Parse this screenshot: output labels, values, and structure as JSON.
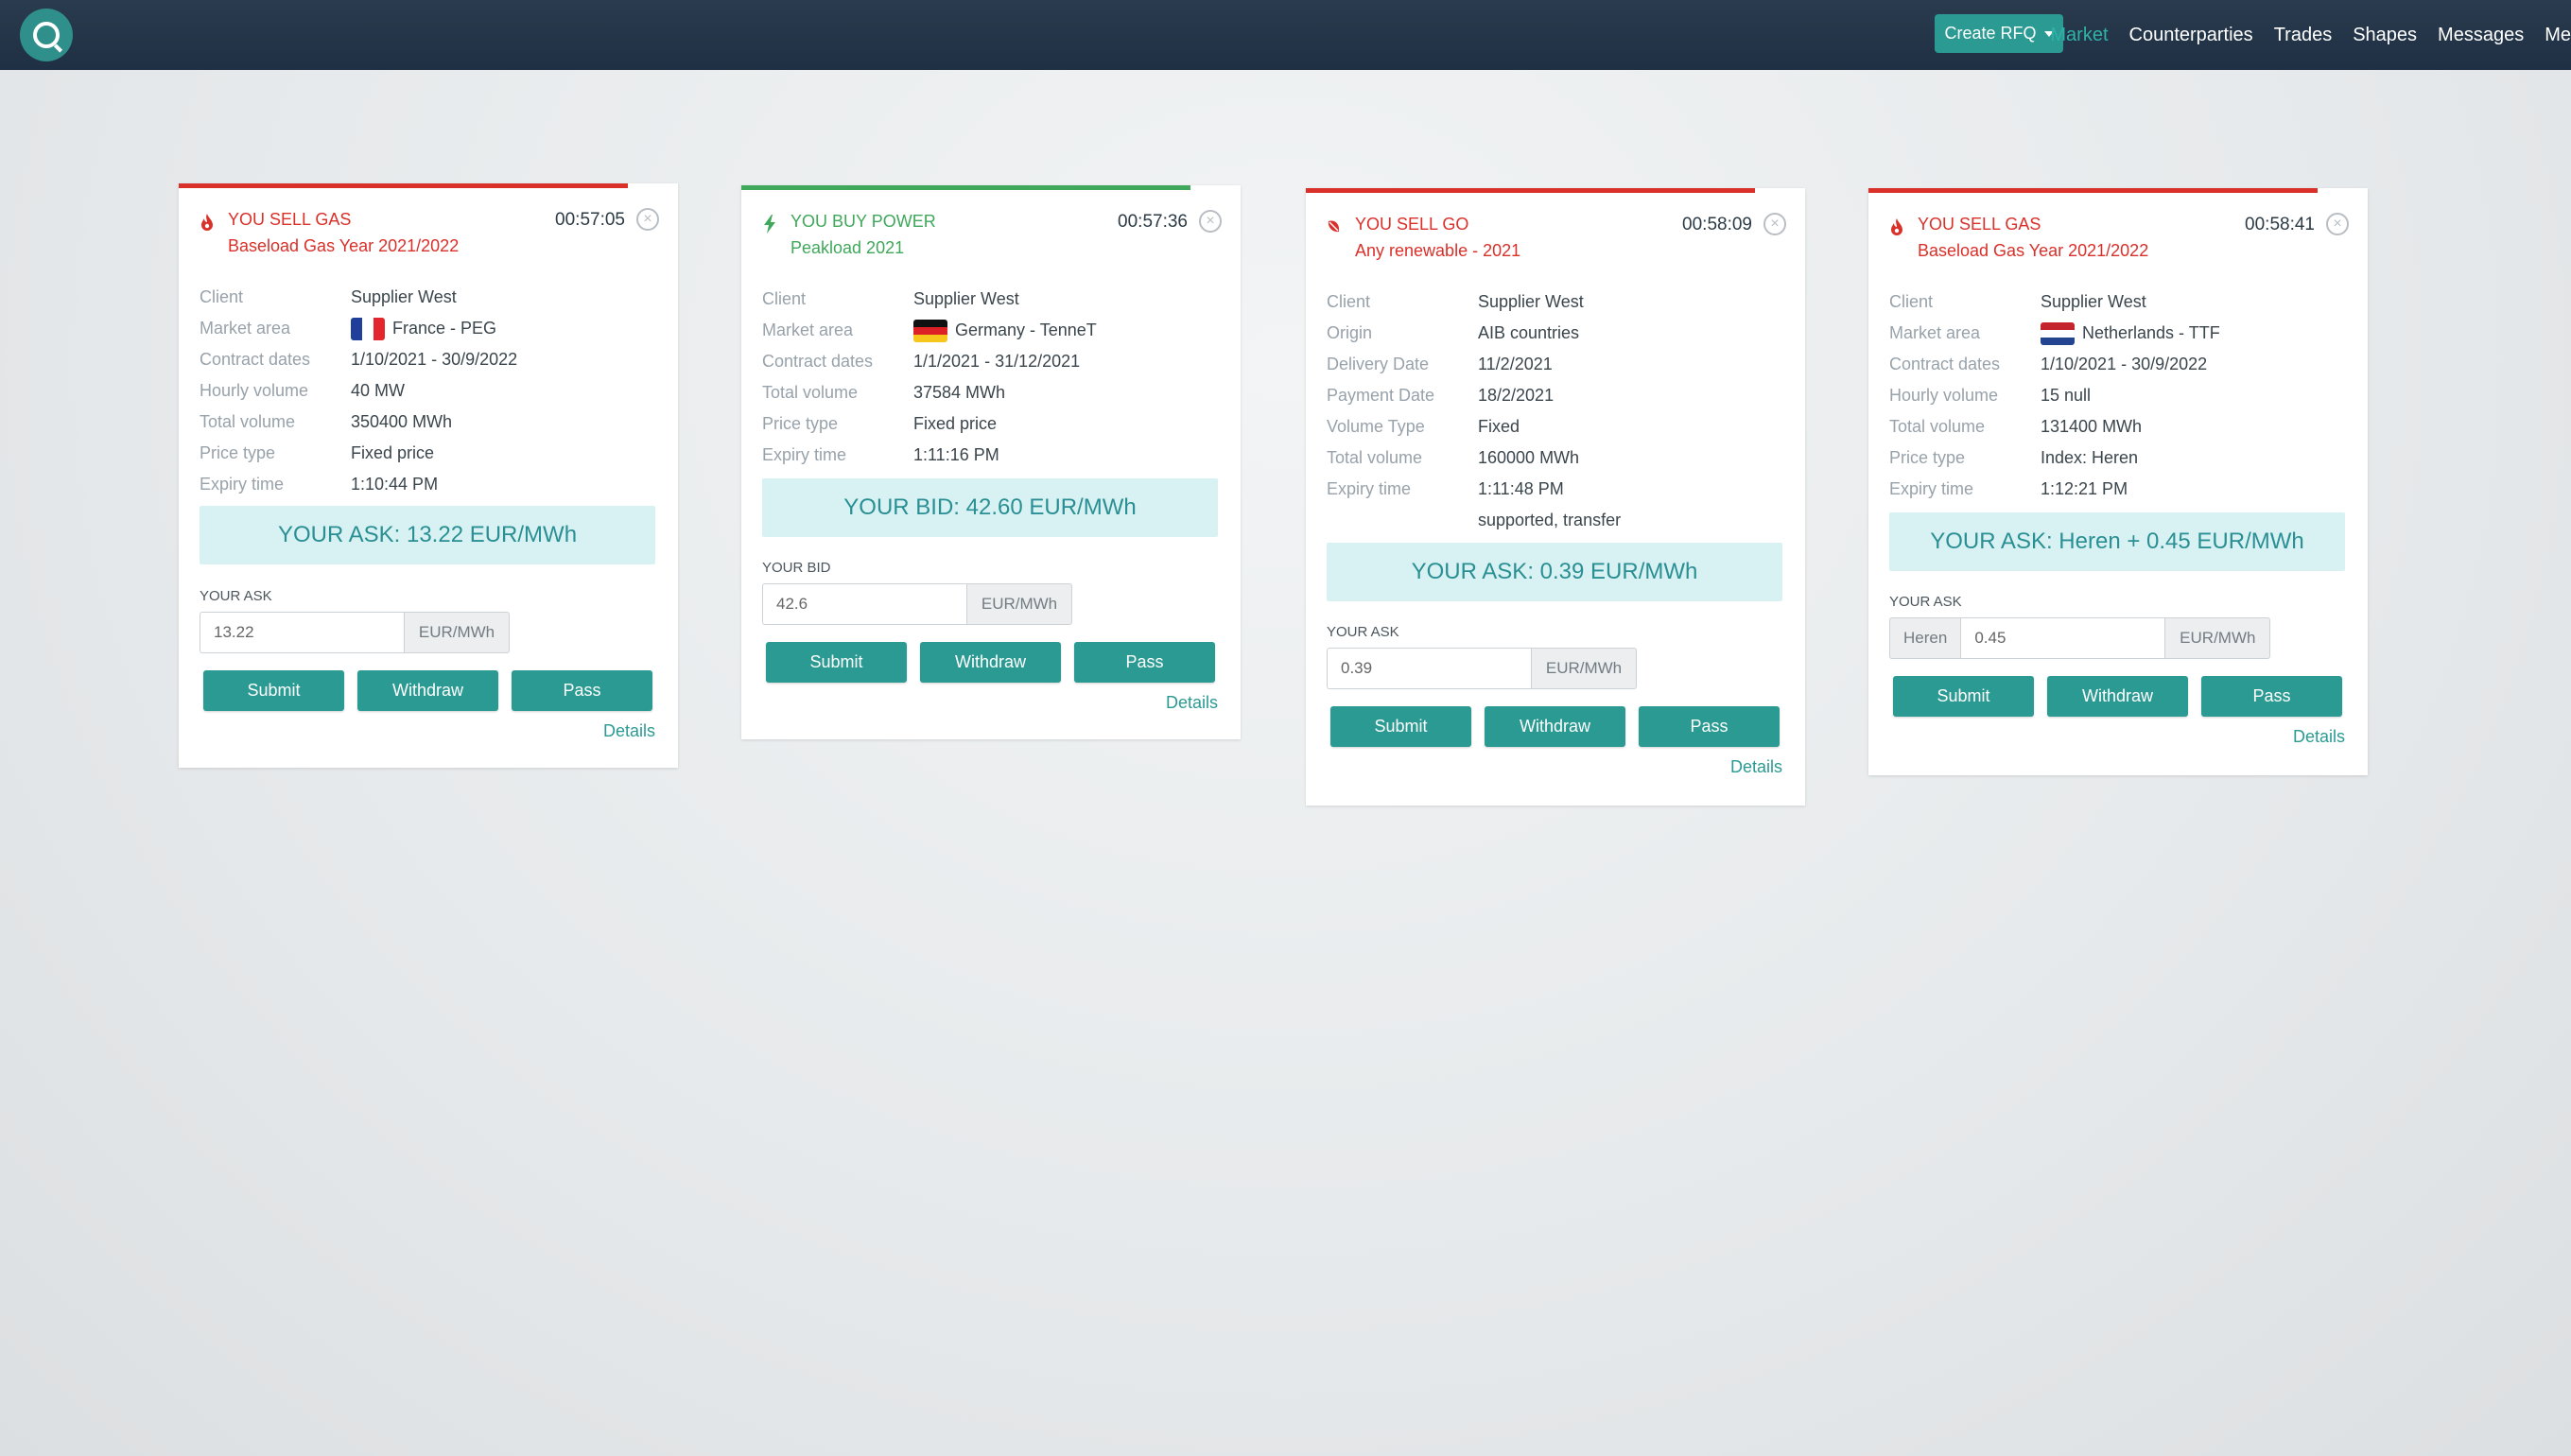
{
  "nav": {
    "create_rfq": "Create RFQ",
    "links": [
      "Market",
      "Counterparties",
      "Trades",
      "Shapes",
      "Messages",
      "Me"
    ]
  },
  "cards": [
    {
      "side": "YOU SELL GAS",
      "product": "Baseload Gas Year 2021/2022",
      "timer": "00:57:05",
      "rows": [
        {
          "label": "Client",
          "value": "Supplier West"
        },
        {
          "label": "Market area",
          "value": "France - PEG",
          "flag": "fr"
        },
        {
          "label": "Contract dates",
          "value": "1/10/2021 - 30/9/2022"
        },
        {
          "label": "Hourly volume",
          "value": "40 MW"
        },
        {
          "label": "Total volume",
          "value": "350400 MWh"
        },
        {
          "label": "Price type",
          "value": "Fixed price"
        },
        {
          "label": "Expiry time",
          "value": "1:10:44 PM"
        }
      ],
      "quote": "YOUR ASK: 13.22 EUR/MWh",
      "your_label": "YOUR ASK",
      "input_value": "13.22",
      "unit": "EUR/MWh",
      "buttons": [
        "Submit",
        "Withdraw",
        "Pass"
      ],
      "details": "Details"
    },
    {
      "side": "YOU BUY POWER",
      "product": "Peakload 2021",
      "timer": "00:57:36",
      "rows": [
        {
          "label": "Client",
          "value": "Supplier West"
        },
        {
          "label": "Market area",
          "value": "Germany - TenneT",
          "flag": "de"
        },
        {
          "label": "Contract dates",
          "value": "1/1/2021 - 31/12/2021"
        },
        {
          "label": "Total volume",
          "value": "37584 MWh"
        },
        {
          "label": "Price type",
          "value": "Fixed price"
        },
        {
          "label": "Expiry time",
          "value": "1:11:16 PM"
        }
      ],
      "quote": "YOUR BID: 42.60 EUR/MWh",
      "your_label": "YOUR BID",
      "input_value": "42.6",
      "unit": "EUR/MWh",
      "buttons": [
        "Submit",
        "Withdraw",
        "Pass"
      ],
      "details": "Details"
    },
    {
      "side": "YOU SELL GO",
      "product": "Any renewable - 2021",
      "timer": "00:58:09",
      "rows": [
        {
          "label": "Client",
          "value": "Supplier West"
        },
        {
          "label": "Origin",
          "value": "AIB countries"
        },
        {
          "label": "Delivery Date",
          "value": "11/2/2021"
        },
        {
          "label": "Payment Date",
          "value": "18/2/2021"
        },
        {
          "label": "Volume Type",
          "value": "Fixed"
        },
        {
          "label": "Total volume",
          "value": "160000 MWh"
        },
        {
          "label": "Expiry time",
          "value": "1:11:48 PM"
        },
        {
          "label": "",
          "value": "supported, transfer"
        }
      ],
      "quote": "YOUR ASK: 0.39 EUR/MWh",
      "your_label": "YOUR ASK",
      "input_value": "0.39",
      "unit": "EUR/MWh",
      "buttons": [
        "Submit",
        "Withdraw",
        "Pass"
      ],
      "details": "Details"
    },
    {
      "side": "YOU SELL GAS",
      "product": "Baseload Gas Year 2021/2022",
      "timer": "00:58:41",
      "rows": [
        {
          "label": "Client",
          "value": "Supplier West"
        },
        {
          "label": "Market area",
          "value": "Netherlands - TTF",
          "flag": "nl"
        },
        {
          "label": "Contract dates",
          "value": "1/10/2021 - 30/9/2022"
        },
        {
          "label": "Hourly volume",
          "value": "15 null"
        },
        {
          "label": "Total volume",
          "value": "131400 MWh"
        },
        {
          "label": "Price type",
          "value": "Index: Heren"
        },
        {
          "label": "Expiry time",
          "value": "1:12:21 PM"
        }
      ],
      "quote": "YOUR ASK: Heren + 0.45 EUR/MWh",
      "your_label": "YOUR ASK",
      "input_prefix": "Heren",
      "input_value": "0.45",
      "unit": "EUR/MWh",
      "buttons": [
        "Submit",
        "Withdraw",
        "Pass"
      ],
      "details": "Details"
    }
  ],
  "colors": {
    "navbar": "#1f3044",
    "accent": "#2a9a93",
    "sell": "#d9302a",
    "buy": "#3fa85a",
    "quote_bg": "#d8f2f4"
  }
}
